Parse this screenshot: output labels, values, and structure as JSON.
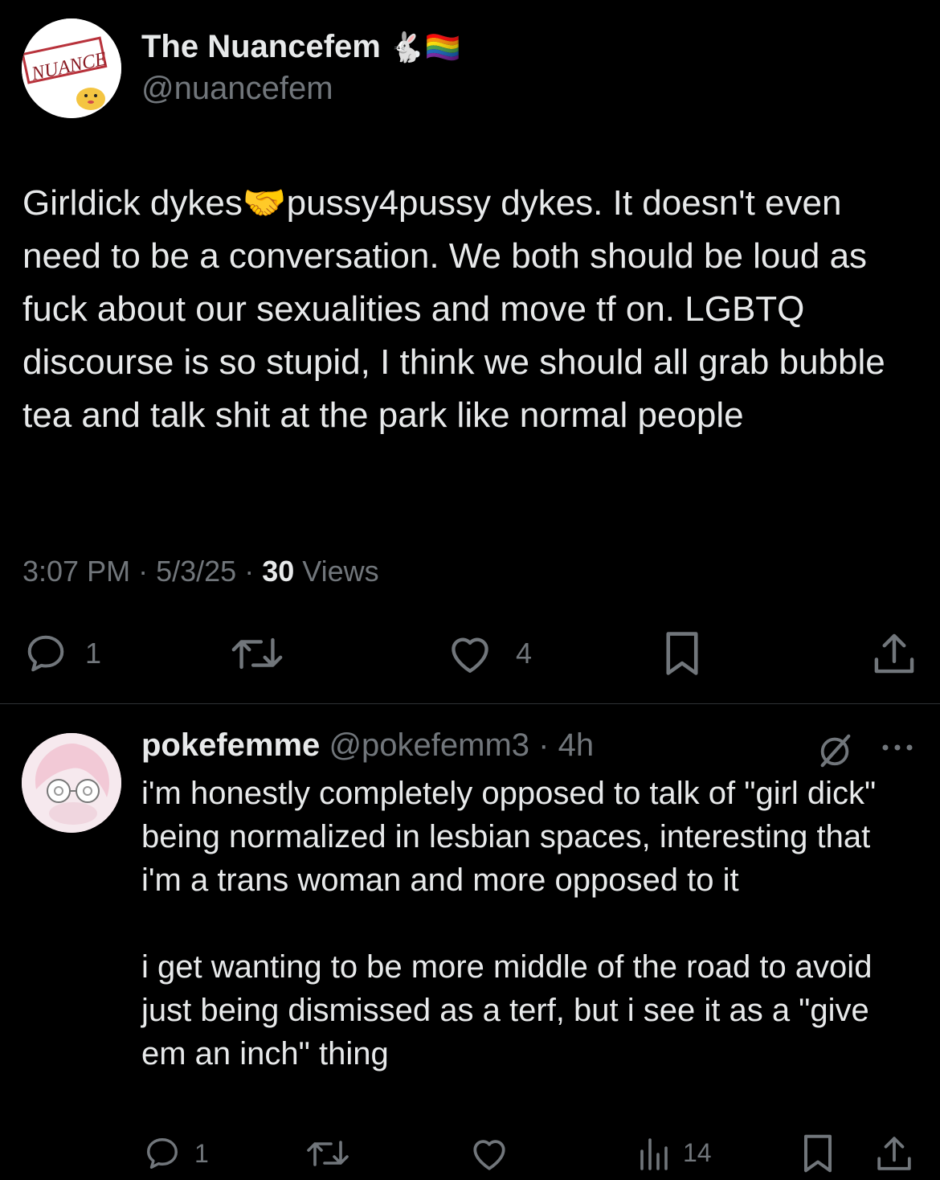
{
  "post": {
    "display_name": "The Nuancefem",
    "name_emojis": "🐇🏳️‍🌈",
    "handle": "@nuancefem",
    "avatar_text": "NUANCE",
    "text_part1": "Girldick dykes",
    "text_emoji": "🤝",
    "text_part2": "pussy4pussy dykes. It doesn't even need to be a conversation. We both should be loud as fuck about our sexualities and move tf on. LGBTQ discourse is so stupid, I think we should all grab bubble tea and talk shit at the park like normal people",
    "time": "3:07 PM",
    "date": "5/3/25",
    "views_count": "30",
    "views_label": "Views",
    "reply_count": "1",
    "like_count": "4"
  },
  "reply": {
    "display_name": "pokefemme",
    "handle": "@pokefemm3",
    "age": "4h",
    "text": "i'm honestly completely opposed to talk of \"girl dick\" being normalized in lesbian spaces, interesting that i'm a trans woman and more opposed to it\n\ni get wanting to be more middle of the road to avoid just being dismissed as a terf, but i see it as a \"give em an inch\" thing",
    "reply_count": "1",
    "views_count": "14"
  },
  "colors": {
    "background": "#000000",
    "text": "#e7e9ea",
    "muted": "#71767b",
    "divider": "#2f3336"
  },
  "icons": [
    "reply-icon",
    "repost-icon",
    "like-icon",
    "bookmark-icon",
    "share-icon",
    "views-icon",
    "more-icon",
    "grok-icon"
  ]
}
